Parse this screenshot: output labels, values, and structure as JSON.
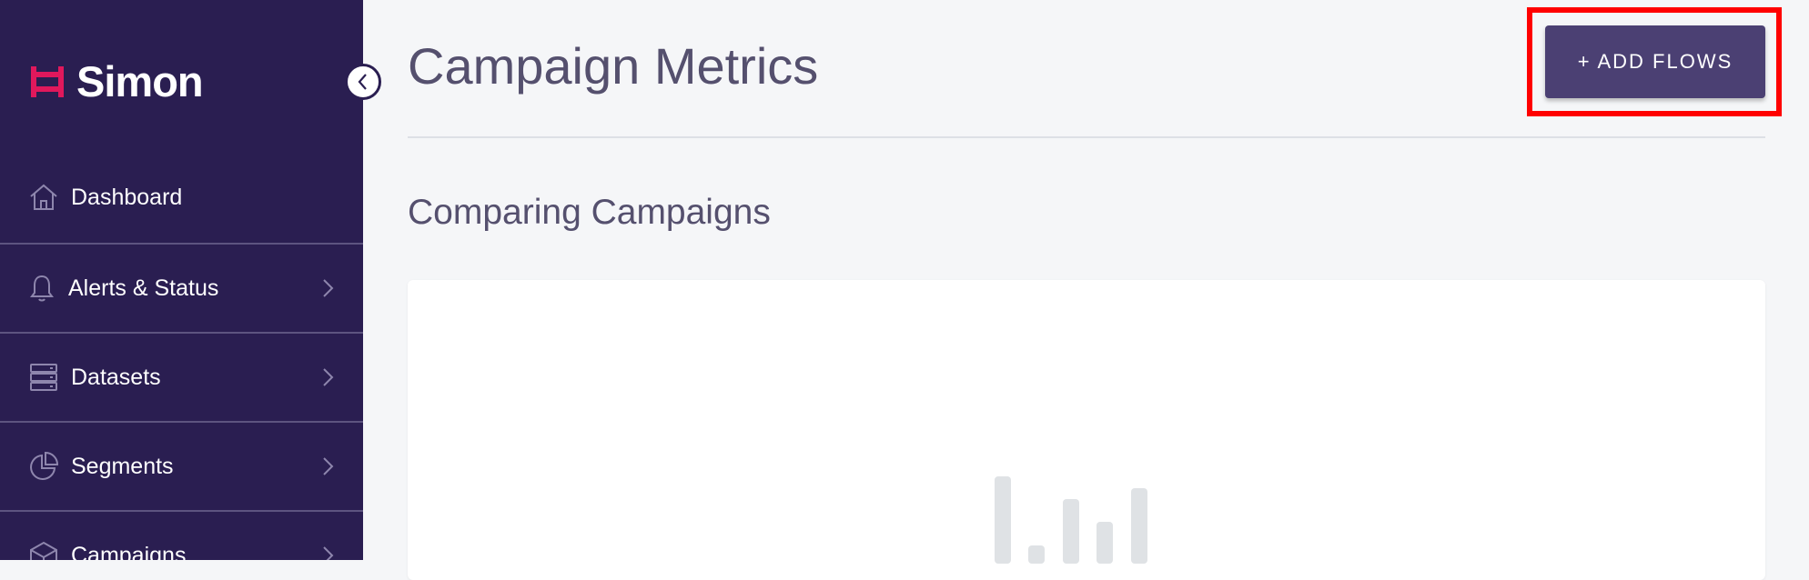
{
  "app": {
    "name": "Simon"
  },
  "sidebar": {
    "items": [
      {
        "label": "Dashboard",
        "icon": "home-icon",
        "has_chevron": false
      },
      {
        "label": "Alerts & Status",
        "icon": "bell-icon",
        "has_chevron": true
      },
      {
        "label": "Datasets",
        "icon": "server-icon",
        "has_chevron": true
      },
      {
        "label": "Segments",
        "icon": "pie-chart-icon",
        "has_chevron": true
      },
      {
        "label": "Campaigns",
        "icon": "cube-icon",
        "has_chevron": true
      }
    ]
  },
  "header": {
    "title": "Campaign Metrics",
    "add_flows_label": "+ ADD FLOWS"
  },
  "main": {
    "section_title": "Comparing Campaigns"
  },
  "colors": {
    "sidebar_bg": "#2a1e51",
    "brand_accent": "#e0185c",
    "button_bg": "#4b4073",
    "heading": "#55506e",
    "page_bg": "#f5f6f8",
    "highlight": "#ff0000"
  }
}
